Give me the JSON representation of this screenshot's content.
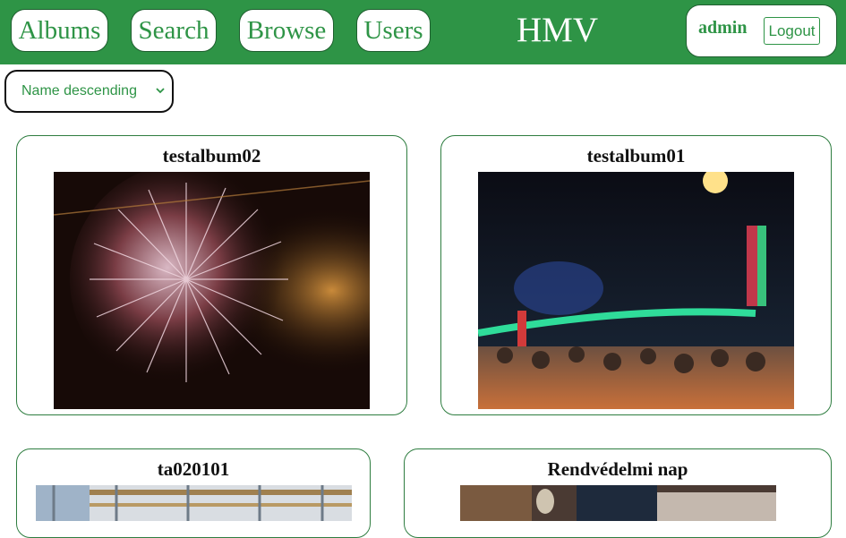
{
  "nav": {
    "albums": "Albums",
    "search": "Search",
    "browse": "Browse",
    "users": "Users"
  },
  "brand": "HMV",
  "user": {
    "name": "admin",
    "logout": "Logout"
  },
  "sort": {
    "selected": "Name descending"
  },
  "albums": [
    {
      "title": "testalbum02",
      "image": "fireworks"
    },
    {
      "title": "testalbum01",
      "image": "bridge-night-crowd"
    },
    {
      "title": "ta020101",
      "image": "interior-shelves"
    },
    {
      "title": "Rendvédelmi nap",
      "image": "indoor-table"
    }
  ],
  "colors": {
    "brand_green": "#2e9446",
    "border_green": "#2e7d40"
  }
}
